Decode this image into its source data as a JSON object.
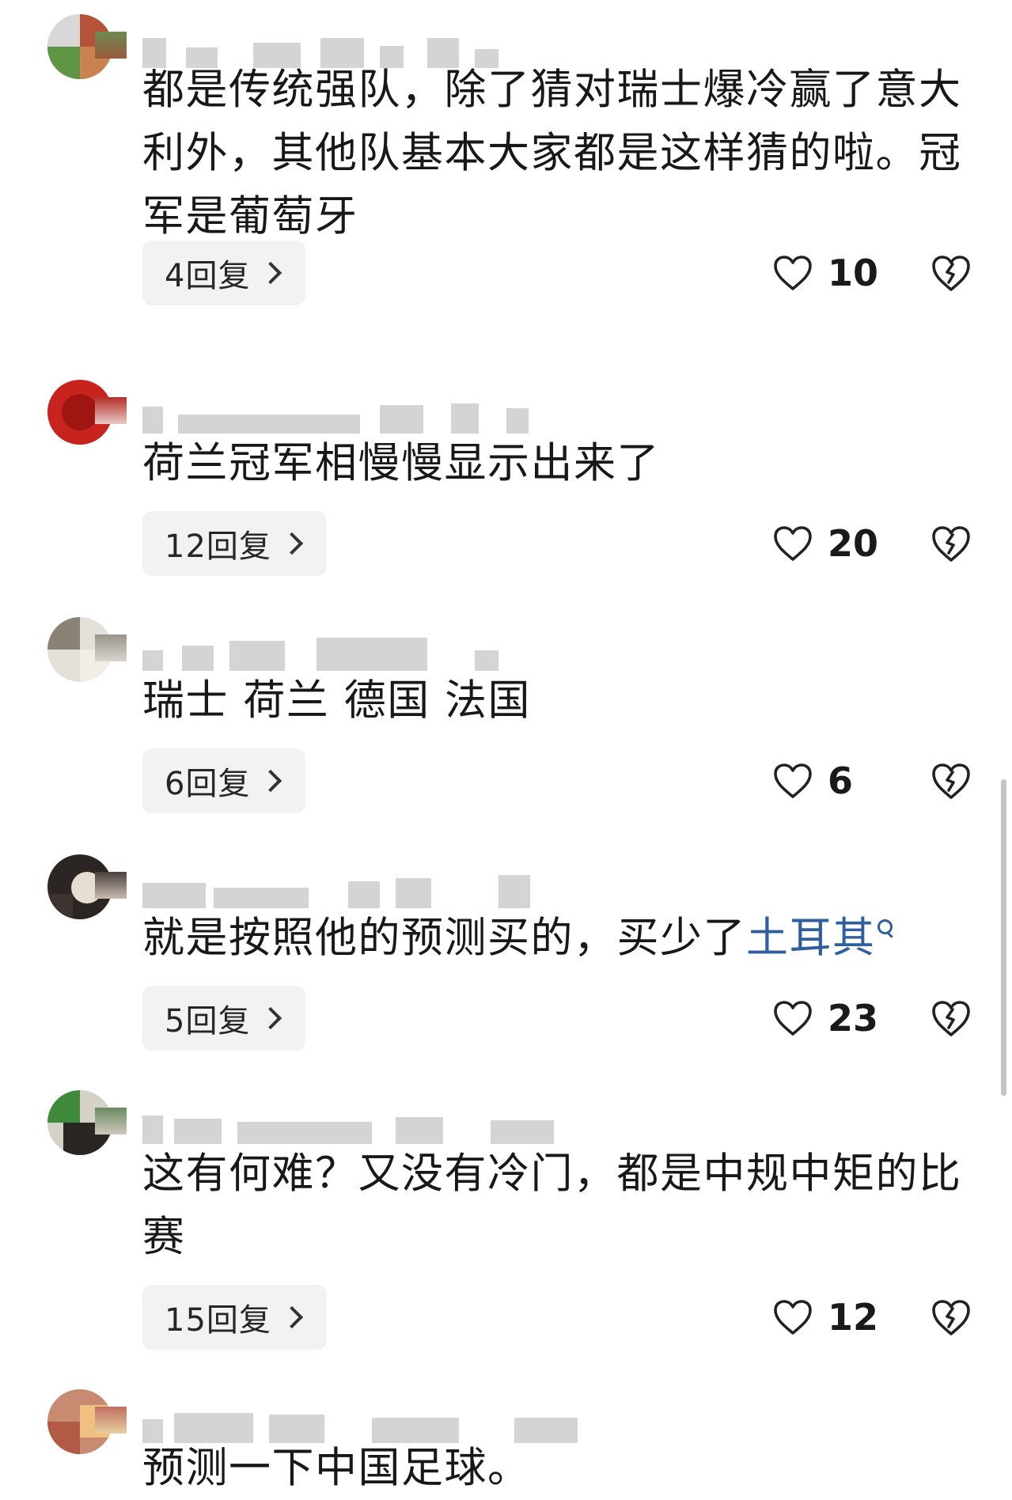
{
  "comments": [
    {
      "text_parts": [
        "都是传统强队，除了猜对瑞士爆冷赢了意大利外，其他队基本大家都是这样猜的啦。冠军是葡萄牙"
      ],
      "replies": "4回复",
      "likes": "10"
    },
    {
      "text_parts": [
        "荷兰冠军相慢慢显示出来了"
      ],
      "replies": "12回复",
      "likes": "20"
    },
    {
      "text_parts": [
        "瑞士 荷兰 德国 法国"
      ],
      "replies": "6回复",
      "likes": "6"
    },
    {
      "text_parts": [
        "就是按照他的预测买的，买少了"
      ],
      "topic_link": "土耳其",
      "replies": "5回复",
      "likes": "23"
    },
    {
      "text_parts": [
        "这有何难？又没有冷门，都是中规中矩的比赛"
      ],
      "replies": "15回复",
      "likes": "12"
    },
    {
      "text_parts": [
        "预测一下中国足球。"
      ]
    }
  ],
  "icons": {
    "reply_chevron": "chevron-right-icon",
    "like": "heart-outline-icon",
    "dislike": "broken-heart-icon",
    "topic_search": "search-icon"
  },
  "colors": {
    "text": "#181818",
    "topic_link": "#2f5f9f",
    "reply_button_bg": "#f2f2f2",
    "censor_block": "#d4d4d4"
  }
}
